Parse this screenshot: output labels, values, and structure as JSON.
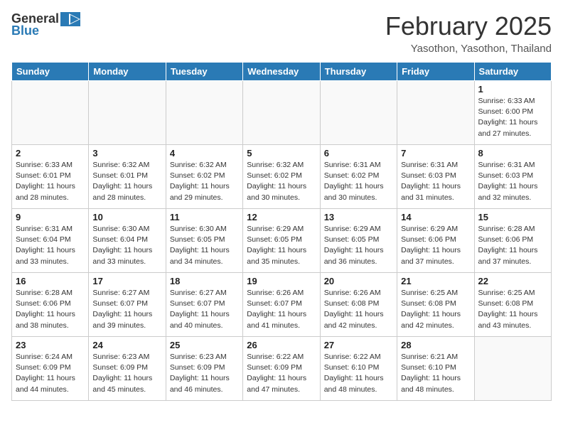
{
  "header": {
    "logo": {
      "general": "General",
      "blue": "Blue"
    },
    "title": "February 2025",
    "location": "Yasothon, Yasothon, Thailand"
  },
  "days_of_week": [
    "Sunday",
    "Monday",
    "Tuesday",
    "Wednesday",
    "Thursday",
    "Friday",
    "Saturday"
  ],
  "weeks": [
    [
      {
        "day": "",
        "info": ""
      },
      {
        "day": "",
        "info": ""
      },
      {
        "day": "",
        "info": ""
      },
      {
        "day": "",
        "info": ""
      },
      {
        "day": "",
        "info": ""
      },
      {
        "day": "",
        "info": ""
      },
      {
        "day": "1",
        "info": "Sunrise: 6:33 AM\nSunset: 6:00 PM\nDaylight: 11 hours and 27 minutes."
      }
    ],
    [
      {
        "day": "2",
        "info": "Sunrise: 6:33 AM\nSunset: 6:01 PM\nDaylight: 11 hours and 28 minutes."
      },
      {
        "day": "3",
        "info": "Sunrise: 6:32 AM\nSunset: 6:01 PM\nDaylight: 11 hours and 28 minutes."
      },
      {
        "day": "4",
        "info": "Sunrise: 6:32 AM\nSunset: 6:02 PM\nDaylight: 11 hours and 29 minutes."
      },
      {
        "day": "5",
        "info": "Sunrise: 6:32 AM\nSunset: 6:02 PM\nDaylight: 11 hours and 30 minutes."
      },
      {
        "day": "6",
        "info": "Sunrise: 6:31 AM\nSunset: 6:02 PM\nDaylight: 11 hours and 30 minutes."
      },
      {
        "day": "7",
        "info": "Sunrise: 6:31 AM\nSunset: 6:03 PM\nDaylight: 11 hours and 31 minutes."
      },
      {
        "day": "8",
        "info": "Sunrise: 6:31 AM\nSunset: 6:03 PM\nDaylight: 11 hours and 32 minutes."
      }
    ],
    [
      {
        "day": "9",
        "info": "Sunrise: 6:31 AM\nSunset: 6:04 PM\nDaylight: 11 hours and 33 minutes."
      },
      {
        "day": "10",
        "info": "Sunrise: 6:30 AM\nSunset: 6:04 PM\nDaylight: 11 hours and 33 minutes."
      },
      {
        "day": "11",
        "info": "Sunrise: 6:30 AM\nSunset: 6:05 PM\nDaylight: 11 hours and 34 minutes."
      },
      {
        "day": "12",
        "info": "Sunrise: 6:29 AM\nSunset: 6:05 PM\nDaylight: 11 hours and 35 minutes."
      },
      {
        "day": "13",
        "info": "Sunrise: 6:29 AM\nSunset: 6:05 PM\nDaylight: 11 hours and 36 minutes."
      },
      {
        "day": "14",
        "info": "Sunrise: 6:29 AM\nSunset: 6:06 PM\nDaylight: 11 hours and 37 minutes."
      },
      {
        "day": "15",
        "info": "Sunrise: 6:28 AM\nSunset: 6:06 PM\nDaylight: 11 hours and 37 minutes."
      }
    ],
    [
      {
        "day": "16",
        "info": "Sunrise: 6:28 AM\nSunset: 6:06 PM\nDaylight: 11 hours and 38 minutes."
      },
      {
        "day": "17",
        "info": "Sunrise: 6:27 AM\nSunset: 6:07 PM\nDaylight: 11 hours and 39 minutes."
      },
      {
        "day": "18",
        "info": "Sunrise: 6:27 AM\nSunset: 6:07 PM\nDaylight: 11 hours and 40 minutes."
      },
      {
        "day": "19",
        "info": "Sunrise: 6:26 AM\nSunset: 6:07 PM\nDaylight: 11 hours and 41 minutes."
      },
      {
        "day": "20",
        "info": "Sunrise: 6:26 AM\nSunset: 6:08 PM\nDaylight: 11 hours and 42 minutes."
      },
      {
        "day": "21",
        "info": "Sunrise: 6:25 AM\nSunset: 6:08 PM\nDaylight: 11 hours and 42 minutes."
      },
      {
        "day": "22",
        "info": "Sunrise: 6:25 AM\nSunset: 6:08 PM\nDaylight: 11 hours and 43 minutes."
      }
    ],
    [
      {
        "day": "23",
        "info": "Sunrise: 6:24 AM\nSunset: 6:09 PM\nDaylight: 11 hours and 44 minutes."
      },
      {
        "day": "24",
        "info": "Sunrise: 6:23 AM\nSunset: 6:09 PM\nDaylight: 11 hours and 45 minutes."
      },
      {
        "day": "25",
        "info": "Sunrise: 6:23 AM\nSunset: 6:09 PM\nDaylight: 11 hours and 46 minutes."
      },
      {
        "day": "26",
        "info": "Sunrise: 6:22 AM\nSunset: 6:09 PM\nDaylight: 11 hours and 47 minutes."
      },
      {
        "day": "27",
        "info": "Sunrise: 6:22 AM\nSunset: 6:10 PM\nDaylight: 11 hours and 48 minutes."
      },
      {
        "day": "28",
        "info": "Sunrise: 6:21 AM\nSunset: 6:10 PM\nDaylight: 11 hours and 48 minutes."
      },
      {
        "day": "",
        "info": ""
      }
    ]
  ]
}
